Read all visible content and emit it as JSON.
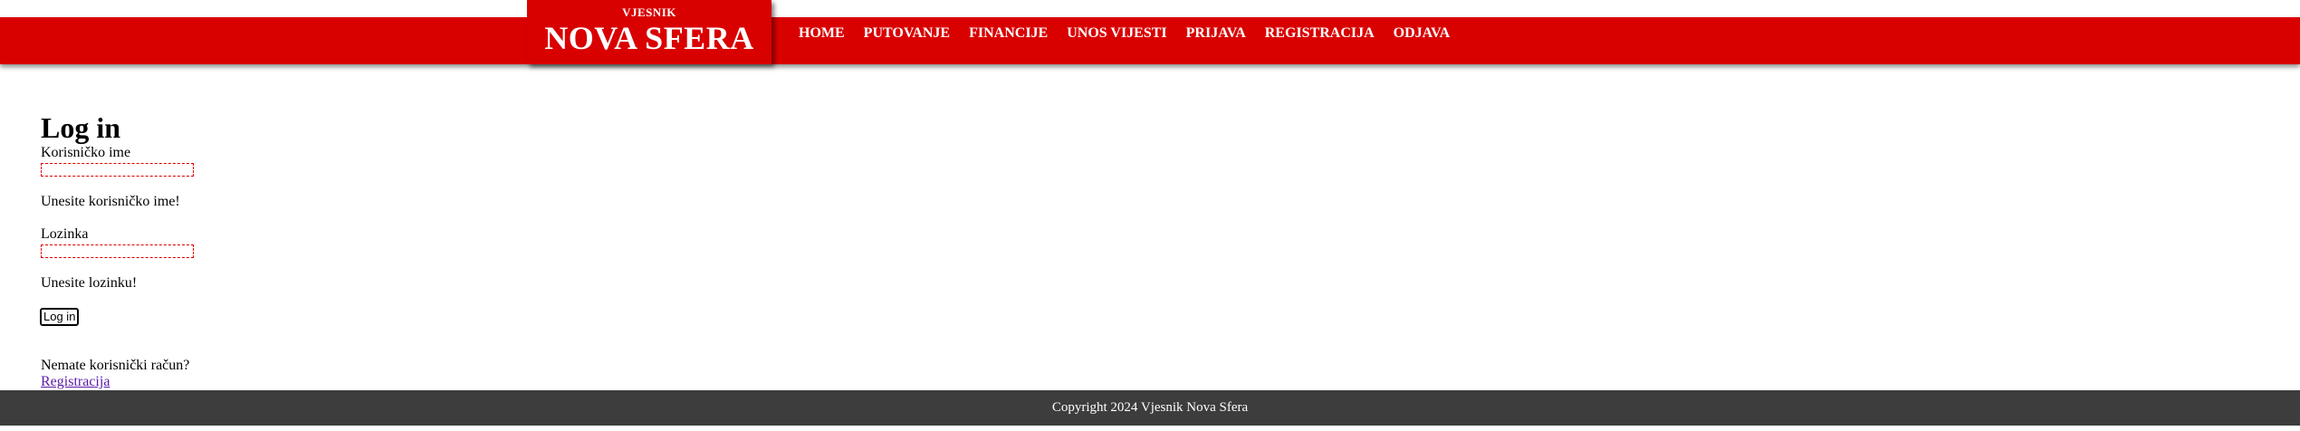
{
  "header": {
    "logo_small": "VJESNIK",
    "logo_big": "NOVA SFERA",
    "brand_color": "#d90000"
  },
  "nav": {
    "items": [
      "HOME",
      "PUTOVANJE",
      "FINANCIJE",
      "UNOS VIJESTI",
      "PRIJAVA",
      "REGISTRACIJA",
      "ODJAVA"
    ]
  },
  "login": {
    "title": "Log in",
    "username_label": "Korisničko ime",
    "username_value": "",
    "username_error": "Unesite korisničko ime!",
    "password_label": "Lozinka",
    "password_value": "",
    "password_error": "Unesite lozinku!",
    "submit_label": "Log in",
    "no_account_text": "Nemate korisnički račun?",
    "register_link": "Registracija"
  },
  "footer": {
    "copyright": "Copyright 2024 Vjesnik Nova Sfera",
    "background": "#3d3d3d"
  }
}
